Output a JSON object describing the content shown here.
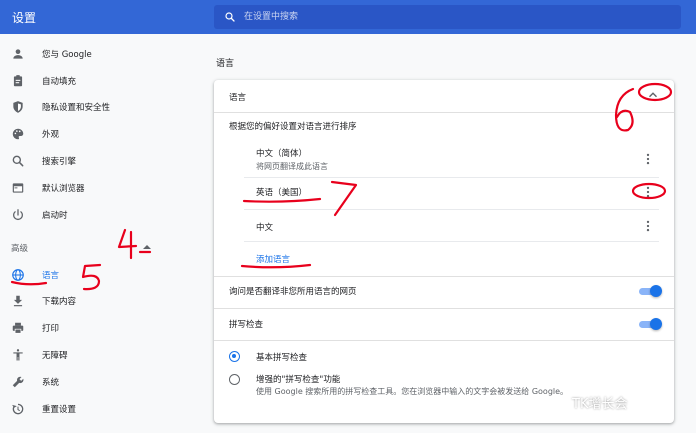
{
  "header": {
    "title": "设置",
    "search_placeholder": "在设置中搜索"
  },
  "sidebar": {
    "items": [
      {
        "label": "您与 Google",
        "icon": "person-icon"
      },
      {
        "label": "自动填充",
        "icon": "clipboard-icon"
      },
      {
        "label": "隐私设置和安全性",
        "icon": "shield-icon"
      },
      {
        "label": "外观",
        "icon": "palette-icon"
      },
      {
        "label": "搜索引擎",
        "icon": "search-icon"
      },
      {
        "label": "默认浏览器",
        "icon": "browser-icon"
      },
      {
        "label": "启动时",
        "icon": "power-icon"
      }
    ],
    "advanced_label": "高级",
    "advanced_items": [
      {
        "label": "语言",
        "icon": "globe-icon",
        "active": true
      },
      {
        "label": "下载内容",
        "icon": "download-icon"
      },
      {
        "label": "打印",
        "icon": "printer-icon"
      },
      {
        "label": "无障碍",
        "icon": "accessibility-icon"
      },
      {
        "label": "系统",
        "icon": "wrench-icon"
      },
      {
        "label": "重置设置",
        "icon": "reset-icon"
      }
    ]
  },
  "main": {
    "section_title": "语言",
    "card": {
      "languages_header": "语言",
      "order_hint": "根据您的偏好设置对语言进行排序",
      "languages": [
        {
          "name": "中文（简体）",
          "sub": "将网页翻译成此语言"
        },
        {
          "name": "英语（美国）",
          "sub": ""
        },
        {
          "name": "中文",
          "sub": ""
        }
      ],
      "add_language": "添加语言",
      "translate_offer": "询问是否翻译非您所用语言的网页",
      "spellcheck_title": "拼写检查",
      "spell_options": [
        {
          "label": "基本拼写检查",
          "checked": true,
          "desc": ""
        },
        {
          "label": "增强的\"拼写检查\"功能",
          "checked": false,
          "desc": "使用 Google 搜索所用的拼写检查工具。您在浏览器中输入的文字会被发送给 Google。"
        }
      ]
    }
  },
  "annotations": {
    "marks": [
      "4",
      "5",
      "6",
      "7"
    ]
  },
  "watermark": {
    "text": "TK增长会"
  },
  "colors": {
    "header_blue": "#3367d6",
    "accent": "#1a73e8",
    "annotation_red": "#e8001c"
  }
}
